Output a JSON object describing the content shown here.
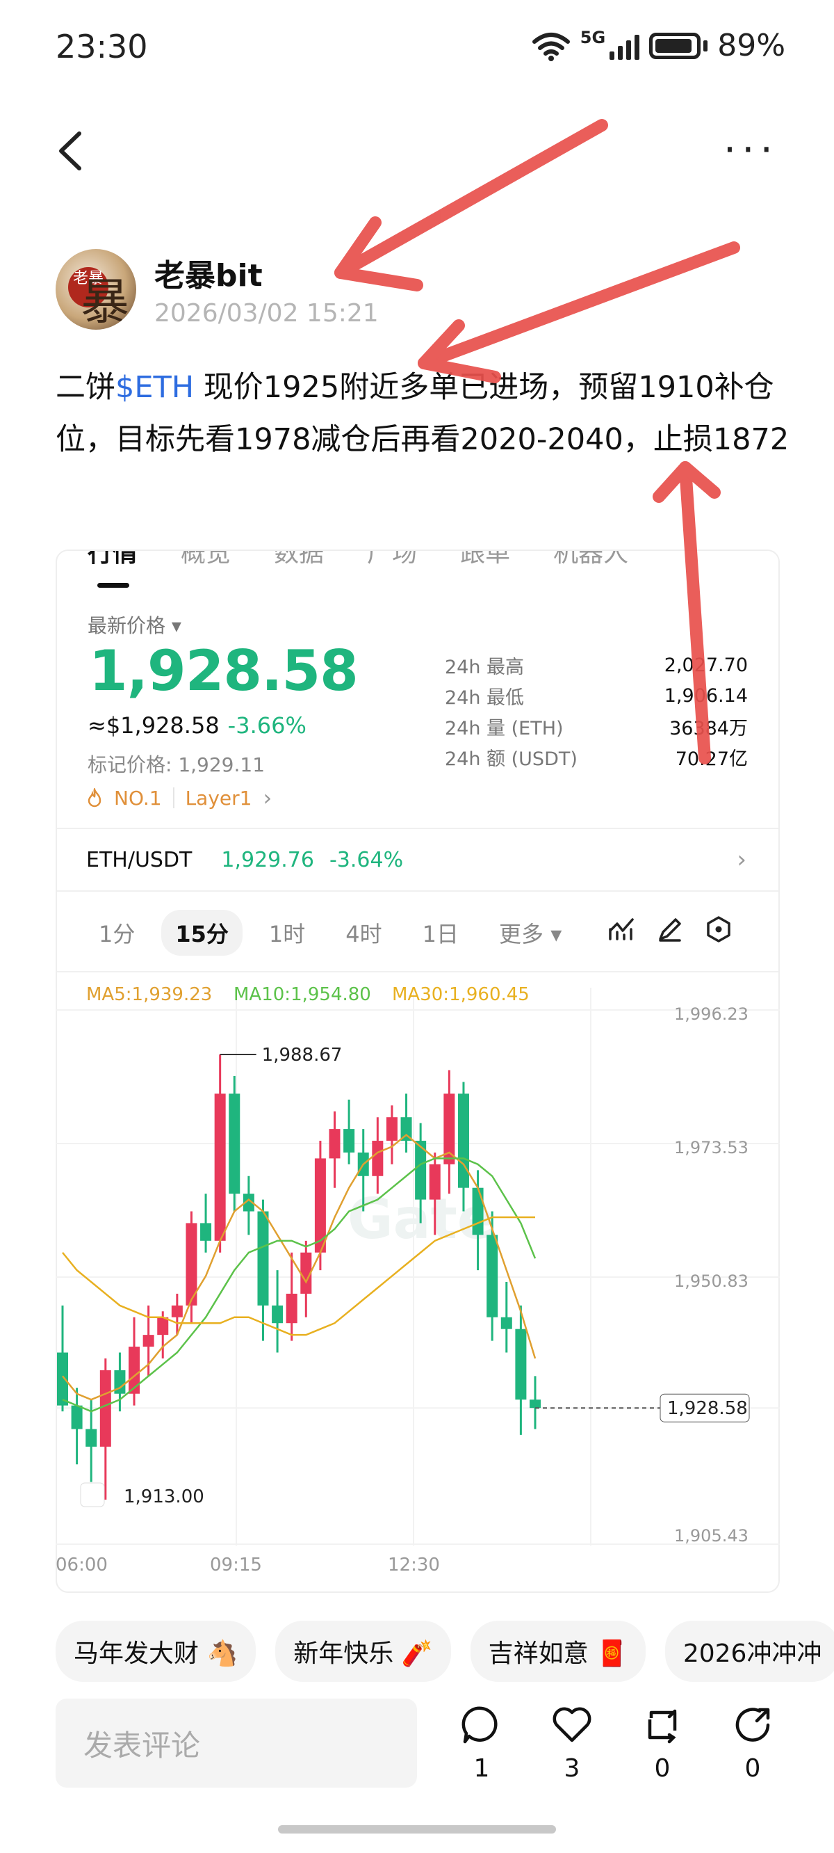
{
  "status_bar": {
    "time": "23:30",
    "network": "5G",
    "battery": "89%"
  },
  "author": {
    "name": "老暴bit",
    "time": "2026/03/02 15:21",
    "avatar_seal": "老暴",
    "avatar_char": "暴"
  },
  "post": {
    "prefix": "二饼",
    "tag": "$ETH",
    "text": " 现价1925附近多单已进场，预留1910补仓位，目标先看1978减仓后再看2020-2040，止损1872"
  },
  "card": {
    "tabs": [
      "行情",
      "概览",
      "数据",
      "广场",
      "跟单",
      "机器人"
    ],
    "latest_price_label": "最新价格 ▾",
    "price": "1,928.58",
    "approx": "≈$1,928.58",
    "change": "-3.66%",
    "mark_price": "标记价格: 1,929.11",
    "rank_badge": "NO.1",
    "category_badge": "Layer1",
    "stats": [
      {
        "label": "24h  最高",
        "value": "2,027.70"
      },
      {
        "label": "24h  最低",
        "value": "1,906.14"
      },
      {
        "label": "24h  量 (ETH)",
        "value": "36384万"
      },
      {
        "label": "24h  额 (USDT)",
        "value": "70.27亿"
      }
    ],
    "pair": "ETH/USDT",
    "pair_price": "1,929.76",
    "pair_change": "-3.64%",
    "intervals": [
      "1分",
      "15分",
      "1时",
      "4时",
      "1日",
      "更多 ▾"
    ],
    "active_interval": "15分"
  },
  "chart_data": {
    "type": "candlestick",
    "ma_labels": [
      "MA5:1,939.23",
      "MA10:1,954.80",
      "MA30:1,960.45"
    ],
    "ma_colors": [
      "#e0a030",
      "#5cc24a",
      "#e8b020"
    ],
    "y_ticks": [
      "1,996.23",
      "1,973.53",
      "1,950.83",
      "1,928.58",
      "1,905.43"
    ],
    "x_ticks": [
      "06:00",
      "09:15",
      "12:30"
    ],
    "ylim": [
      1905.43,
      1996.23
    ],
    "high_label": "1,988.67",
    "low_label": "1,913.00",
    "last_price_label": "1,928.58",
    "watermark": "Gate",
    "up_color": "#e8395a",
    "down_color": "#1fb57e",
    "candles": [
      [
        1938,
        1946,
        1928,
        1929
      ],
      [
        1929,
        1932,
        1919,
        1925
      ],
      [
        1925,
        1930,
        1916,
        1922
      ],
      [
        1922,
        1937,
        1913,
        1935
      ],
      [
        1935,
        1938,
        1928,
        1931
      ],
      [
        1931,
        1944,
        1929,
        1939
      ],
      [
        1939,
        1946,
        1934,
        1941
      ],
      [
        1941,
        1945,
        1937,
        1944
      ],
      [
        1944,
        1948,
        1941,
        1946
      ],
      [
        1946,
        1962,
        1943,
        1960
      ],
      [
        1960,
        1965,
        1955,
        1957
      ],
      [
        1957,
        1988.67,
        1955,
        1982
      ],
      [
        1982,
        1985,
        1962,
        1965
      ],
      [
        1965,
        1968,
        1958,
        1962
      ],
      [
        1962,
        1964,
        1940,
        1946
      ],
      [
        1946,
        1952,
        1938,
        1943
      ],
      [
        1943,
        1955,
        1940,
        1948
      ],
      [
        1948,
        1957,
        1944,
        1955
      ],
      [
        1955,
        1974,
        1952,
        1971
      ],
      [
        1971,
        1979,
        1966,
        1976
      ],
      [
        1976,
        1981,
        1970,
        1972
      ],
      [
        1972,
        1976,
        1962,
        1968
      ],
      [
        1968,
        1978,
        1965,
        1974
      ],
      [
        1974,
        1980,
        1970,
        1978
      ],
      [
        1978,
        1982,
        1972,
        1974
      ],
      [
        1974,
        1977,
        1960,
        1964
      ],
      [
        1964,
        1972,
        1958,
        1970
      ],
      [
        1970,
        1986,
        1965,
        1982
      ],
      [
        1982,
        1984,
        1962,
        1966
      ],
      [
        1966,
        1969,
        1952,
        1958
      ],
      [
        1958,
        1962,
        1940,
        1944
      ],
      [
        1944,
        1950,
        1938,
        1942
      ],
      [
        1942,
        1946,
        1924,
        1930
      ],
      [
        1930,
        1934,
        1925,
        1928.58
      ]
    ],
    "ma5": [
      1934,
      1931,
      1930,
      1931,
      1932,
      1934,
      1936,
      1939,
      1941,
      1947,
      1951,
      1957,
      1962,
      1964,
      1962,
      1958,
      1954,
      1950,
      1955,
      1961,
      1966,
      1970,
      1972,
      1973,
      1975,
      1973,
      1971,
      1972,
      1970,
      1966,
      1959,
      1952,
      1945,
      1937
    ],
    "ma10": [
      1930,
      1929,
      1928,
      1929,
      1930,
      1932,
      1934,
      1936,
      1938,
      1941,
      1944,
      1948,
      1952,
      1955,
      1956,
      1957,
      1957,
      1956,
      1957,
      1959,
      1962,
      1963,
      1964,
      1966,
      1968,
      1970,
      1971,
      1971,
      1971,
      1970,
      1968,
      1964,
      1960,
      1954
    ],
    "ma30": [
      1955,
      1952,
      1950,
      1948,
      1946,
      1945,
      1944,
      1944,
      1943,
      1943,
      1943,
      1943,
      1944,
      1944,
      1943,
      1942,
      1941,
      1941,
      1942,
      1943,
      1945,
      1947,
      1949,
      1951,
      1953,
      1955,
      1957,
      1958,
      1959,
      1960,
      1961,
      1961,
      1961,
      1961
    ]
  },
  "chips": [
    "马年发大财 🐴",
    "新年快乐 🧨",
    "吉祥如意 🧧",
    "2026冲冲冲"
  ],
  "comment_placeholder": "发表评论",
  "actions": [
    {
      "icon": "comment-icon",
      "count": "1"
    },
    {
      "icon": "heart-icon",
      "count": "3"
    },
    {
      "icon": "repost-icon",
      "count": "0"
    },
    {
      "icon": "share-icon",
      "count": "0"
    }
  ],
  "annotation_color": "#e8504c"
}
